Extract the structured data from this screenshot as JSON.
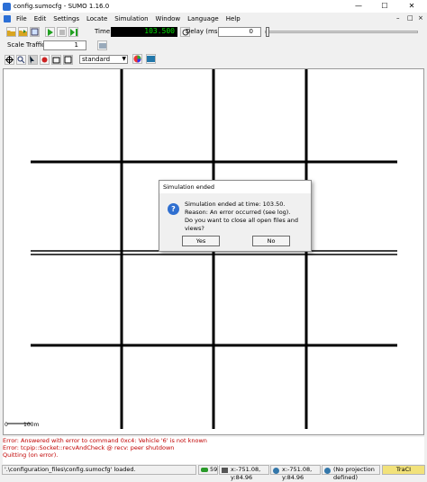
{
  "window": {
    "title": "config.sumocfg - SUMO 1.16.0",
    "minimize": "—",
    "maximize": "☐",
    "close": "✕"
  },
  "menu": [
    "File",
    "Edit",
    "Settings",
    "Locate",
    "Simulation",
    "Window",
    "Language",
    "Help"
  ],
  "mdi": {
    "minimize": "–",
    "restore": "□",
    "close": "×"
  },
  "toolbar": {
    "time_label": "Time:",
    "time_value": "103.500",
    "delay_label": "Delay (ms):",
    "delay_value": "0",
    "scale_label": "Scale Traffic:",
    "scale_value": "1",
    "scheme_value": "standard"
  },
  "dialog": {
    "title": "Simulation ended",
    "line1": "Simulation ended at time: 103.50.",
    "line2": "Reason: An error occurred (see log).",
    "line3": "Do you want to close all open files and views?",
    "yes": "Yes",
    "no": "No"
  },
  "scale_bar": {
    "zero": "0",
    "length": "100m"
  },
  "log": {
    "line1": "Error: Answered with error to command 0xc4: Vehicle '6' is not known",
    "line2": "Error: tcpip::Socket::recvAndCheck @ recv: peer shutdown",
    "line3": "Quitting (on error)."
  },
  "status": {
    "message": "'.\\configuration_files\\config.sumocfg' loaded.",
    "vehicle_count": "59",
    "coords1": "x:-751.08, y:84.96",
    "coords2": "x:-751.08, y:84.96",
    "projection": "(No projection defined)",
    "traci": "TraCI"
  }
}
